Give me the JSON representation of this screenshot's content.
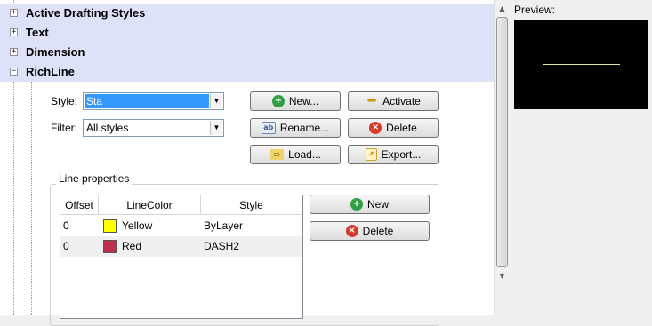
{
  "tree": {
    "categories": [
      {
        "label": "Active Drafting Styles",
        "expander": "+"
      },
      {
        "label": "Text",
        "expander": "+"
      },
      {
        "label": "Dimension",
        "expander": "+"
      },
      {
        "label": "RichLine",
        "expander": "−"
      }
    ]
  },
  "richline": {
    "style_label": "Style:",
    "style_value": "Sta",
    "filter_label": "Filter:",
    "filter_value": "All styles",
    "buttons": {
      "new": "New...",
      "activate": "Activate",
      "rename": "Rename...",
      "delete": "Delete",
      "load": "Load...",
      "export": "Export..."
    }
  },
  "line_properties": {
    "title": "Line properties",
    "columns": [
      "Offset",
      "LineColor",
      "Style"
    ],
    "rows": [
      {
        "offset": "0",
        "color_name": "Yellow",
        "color": "#ffff00",
        "style": "ByLayer"
      },
      {
        "offset": "0",
        "color_name": "Red",
        "color": "#c0304c",
        "style": "DASH2"
      }
    ],
    "new_button": "New",
    "delete_button": "Delete"
  },
  "preview": {
    "label": "Preview:",
    "background": "#000000",
    "line_color": "#e6e6b0"
  },
  "icons": {
    "new": "plus-circle-icon",
    "delete": "x-circle-icon",
    "activate": "arrow-right-icon",
    "rename": "rename-icon",
    "load": "folder-open-icon",
    "export": "export-icon"
  }
}
